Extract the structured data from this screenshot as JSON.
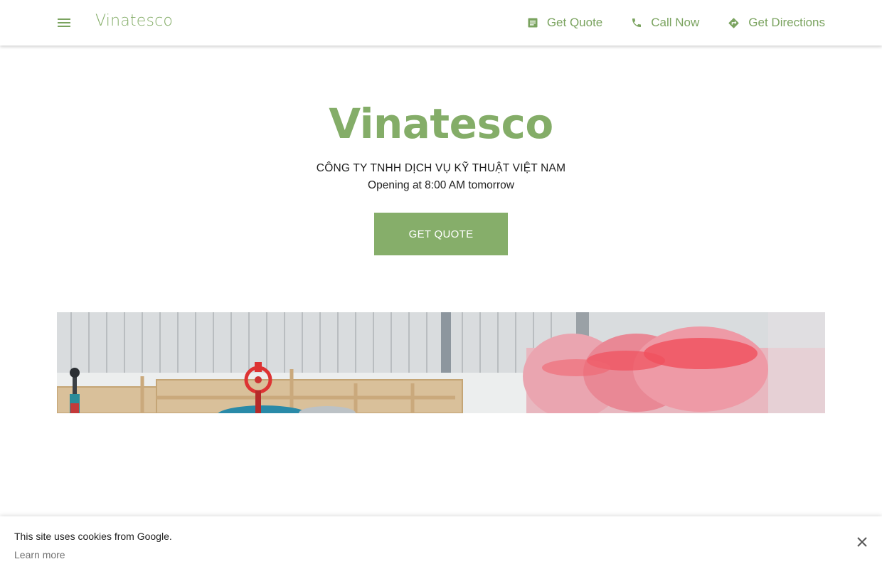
{
  "header": {
    "brand": "Vinatesco",
    "nav": [
      {
        "label": "Get Quote",
        "icon": "quote-icon"
      },
      {
        "label": "Call Now",
        "icon": "phone-icon"
      },
      {
        "label": "Get Directions",
        "icon": "directions-icon"
      }
    ]
  },
  "hero": {
    "title": "Vinatesco",
    "subtitle": "CÔNG TY TNHH DỊCH VỤ KỸ THUẬT VIỆT NAM",
    "status": "Opening at 8:00 AM tomorrow",
    "cta_label": "GET QUOTE"
  },
  "cookie": {
    "message": "This site uses cookies from Google.",
    "link": "Learn more"
  },
  "colors": {
    "accent": "#86ae6a",
    "brand_text": "#84ad68"
  }
}
